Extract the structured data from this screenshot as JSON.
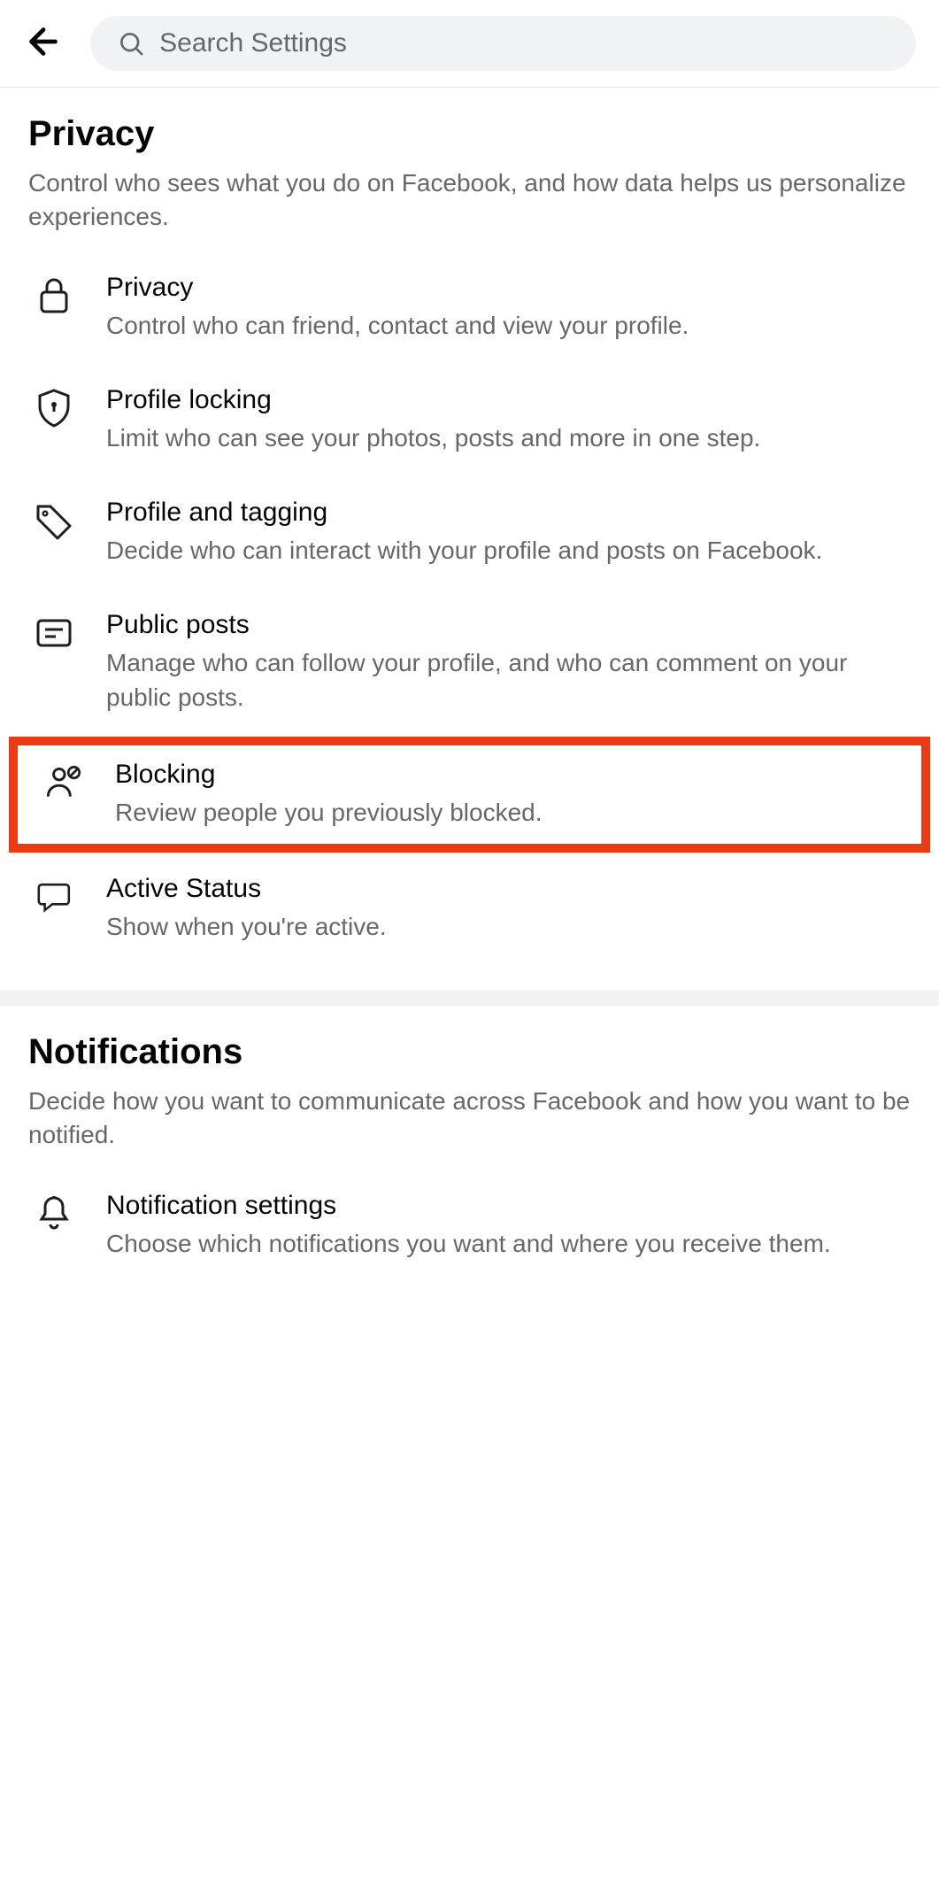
{
  "header": {
    "search_placeholder": "Search Settings"
  },
  "sections": {
    "privacy": {
      "title": "Privacy",
      "desc": "Control who sees what you do on Facebook, and how data helps us personalize experiences.",
      "items": [
        {
          "title": "Privacy",
          "desc": "Control who can friend, contact and view your profile."
        },
        {
          "title": "Profile locking",
          "desc": "Limit who can see your photos, posts and more in one step."
        },
        {
          "title": "Profile and tagging",
          "desc": "Decide who can interact with your profile and posts on Facebook."
        },
        {
          "title": "Public posts",
          "desc": "Manage who can follow your profile, and who can comment on your public posts."
        },
        {
          "title": "Blocking",
          "desc": "Review people you previously blocked."
        },
        {
          "title": "Active Status",
          "desc": "Show when you're active."
        }
      ]
    },
    "notifications": {
      "title": "Notifications",
      "desc": "Decide how you want to communicate across Facebook and how you want to be notified.",
      "items": [
        {
          "title": "Notification settings",
          "desc": "Choose which notifications you want and where you receive them."
        }
      ]
    }
  }
}
